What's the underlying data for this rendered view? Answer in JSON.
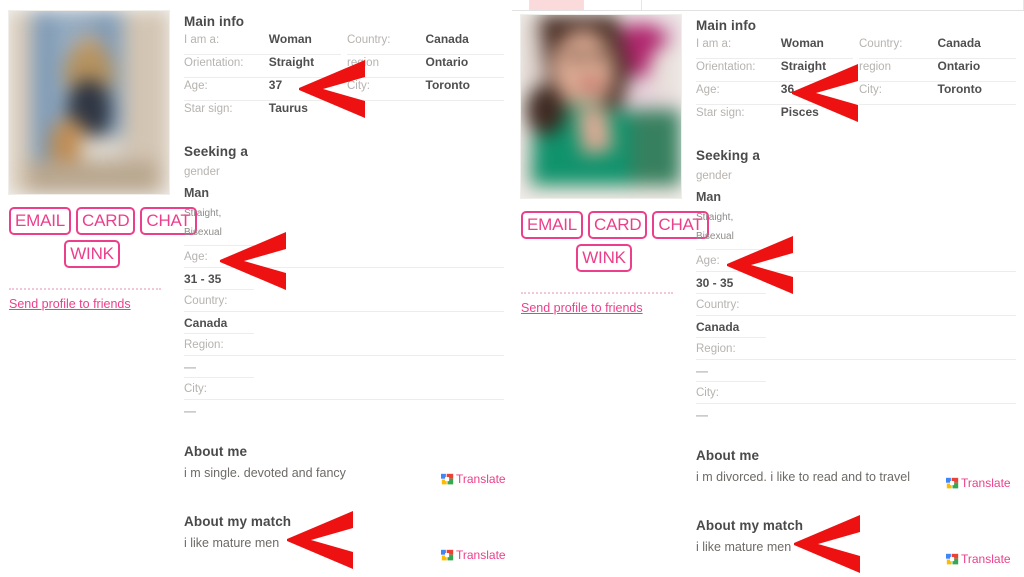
{
  "accent_pink": "#ec3f8b",
  "arrow_red": "#ee1111",
  "actions": {
    "email": "EMAIL",
    "card": "CARD",
    "chat": "CHAT",
    "wink": "WINK",
    "send_profile": "Send profile to friends"
  },
  "labels": {
    "main_info": "Main info",
    "seeking_a": "Seeking a",
    "about_me": "About me",
    "about_my_match": "About my match",
    "translate": "Translate",
    "i_am_a": "I am a:",
    "orientation": "Orientation:",
    "age": "Age:",
    "star_sign": "Star sign:",
    "country": "Country:",
    "city": "City:",
    "region_colon": "Region:",
    "gender": "gender"
  },
  "profiles": [
    {
      "id": "left",
      "main_info": {
        "left_rows": [
          {
            "label": "I am a:",
            "value": "Woman"
          },
          {
            "label": "Orientation:",
            "value": "Straight"
          },
          {
            "label": "Age:",
            "value": "37"
          },
          {
            "label": "Star sign:",
            "value": "Taurus"
          }
        ],
        "right_rows": [
          {
            "label": "Country:",
            "value": "Canada"
          },
          {
            "label": "region",
            "value": "Ontario"
          },
          {
            "label": "City:",
            "value": "Toronto"
          }
        ]
      },
      "seeking": {
        "gender_label": "gender",
        "gender_value": "Man",
        "orientations": "Straight, Bisexual",
        "age_label": "Age:",
        "age_value": "31 - 35",
        "country_label": "Country:",
        "country_value": "Canada",
        "region_label": "Region:",
        "region_value": "—",
        "city_label": "City:",
        "city_value": "—"
      },
      "about_me": "i m single. devoted and fancy",
      "about_my_match": "i like mature men"
    },
    {
      "id": "right",
      "main_info": {
        "left_rows": [
          {
            "label": "I am a:",
            "value": "Woman"
          },
          {
            "label": "Orientation:",
            "value": "Straight"
          },
          {
            "label": "Age:",
            "value": "36"
          },
          {
            "label": "Star sign:",
            "value": "Pisces"
          }
        ],
        "right_rows": [
          {
            "label": "Country:",
            "value": "Canada"
          },
          {
            "label": "region",
            "value": "Ontario"
          },
          {
            "label": "City:",
            "value": "Toronto"
          }
        ]
      },
      "seeking": {
        "gender_label": "gender",
        "gender_value": "Man",
        "orientations": "Straight, Bisexual",
        "age_label": "Age:",
        "age_value": "30 - 35",
        "country_label": "Country:",
        "country_value": "Canada",
        "region_label": "Region:",
        "region_value": "—",
        "city_label": "City:",
        "city_value": "—"
      },
      "about_me": "i m divorced. i like to read and to travel",
      "about_my_match": "i like mature men"
    }
  ]
}
